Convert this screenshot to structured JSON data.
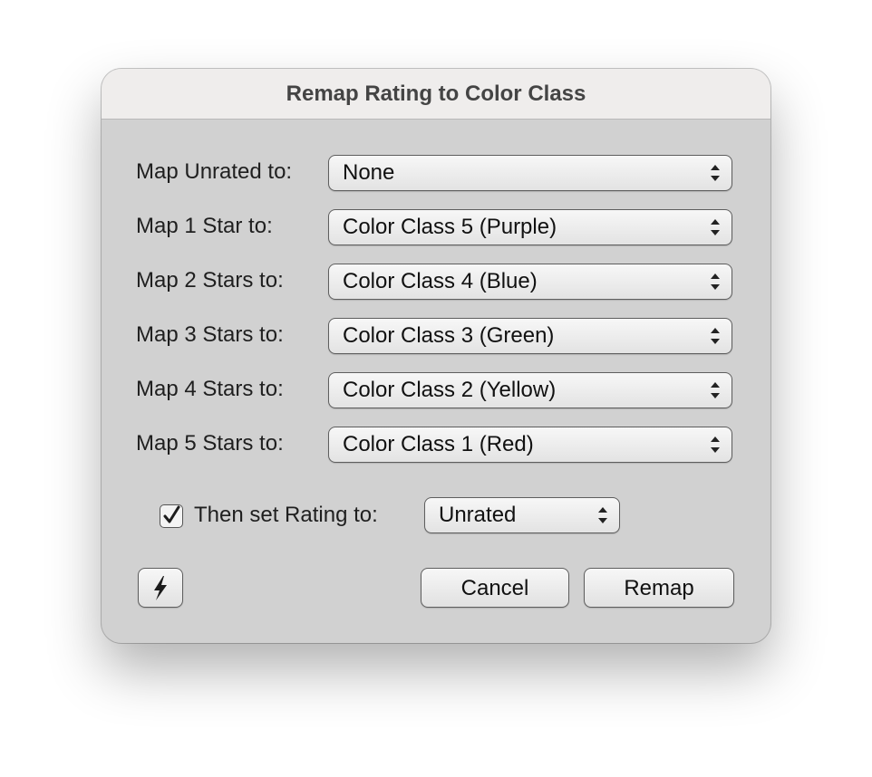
{
  "dialog": {
    "title": "Remap Rating to Color Class"
  },
  "rows": [
    {
      "label": "Map Unrated to:",
      "value": "None"
    },
    {
      "label": "Map 1 Star to:",
      "value": "Color Class 5 (Purple)"
    },
    {
      "label": "Map 2 Stars to:",
      "value": "Color Class 4 (Blue)"
    },
    {
      "label": "Map 3 Stars to:",
      "value": "Color Class 3 (Green)"
    },
    {
      "label": "Map 4 Stars to:",
      "value": "Color Class 2 (Yellow)"
    },
    {
      "label": "Map 5 Stars to:",
      "value": "Color Class 1 (Red)"
    }
  ],
  "rating_option": {
    "checked": true,
    "label": "Then set Rating to:",
    "value": "Unrated"
  },
  "buttons": {
    "action_icon": "lightning-bolt-icon",
    "cancel": "Cancel",
    "remap": "Remap"
  },
  "colors": {
    "window_bg": "#d1d1d1",
    "titlebar_bg": "#efedec",
    "control_border": "#5e5e5e"
  }
}
